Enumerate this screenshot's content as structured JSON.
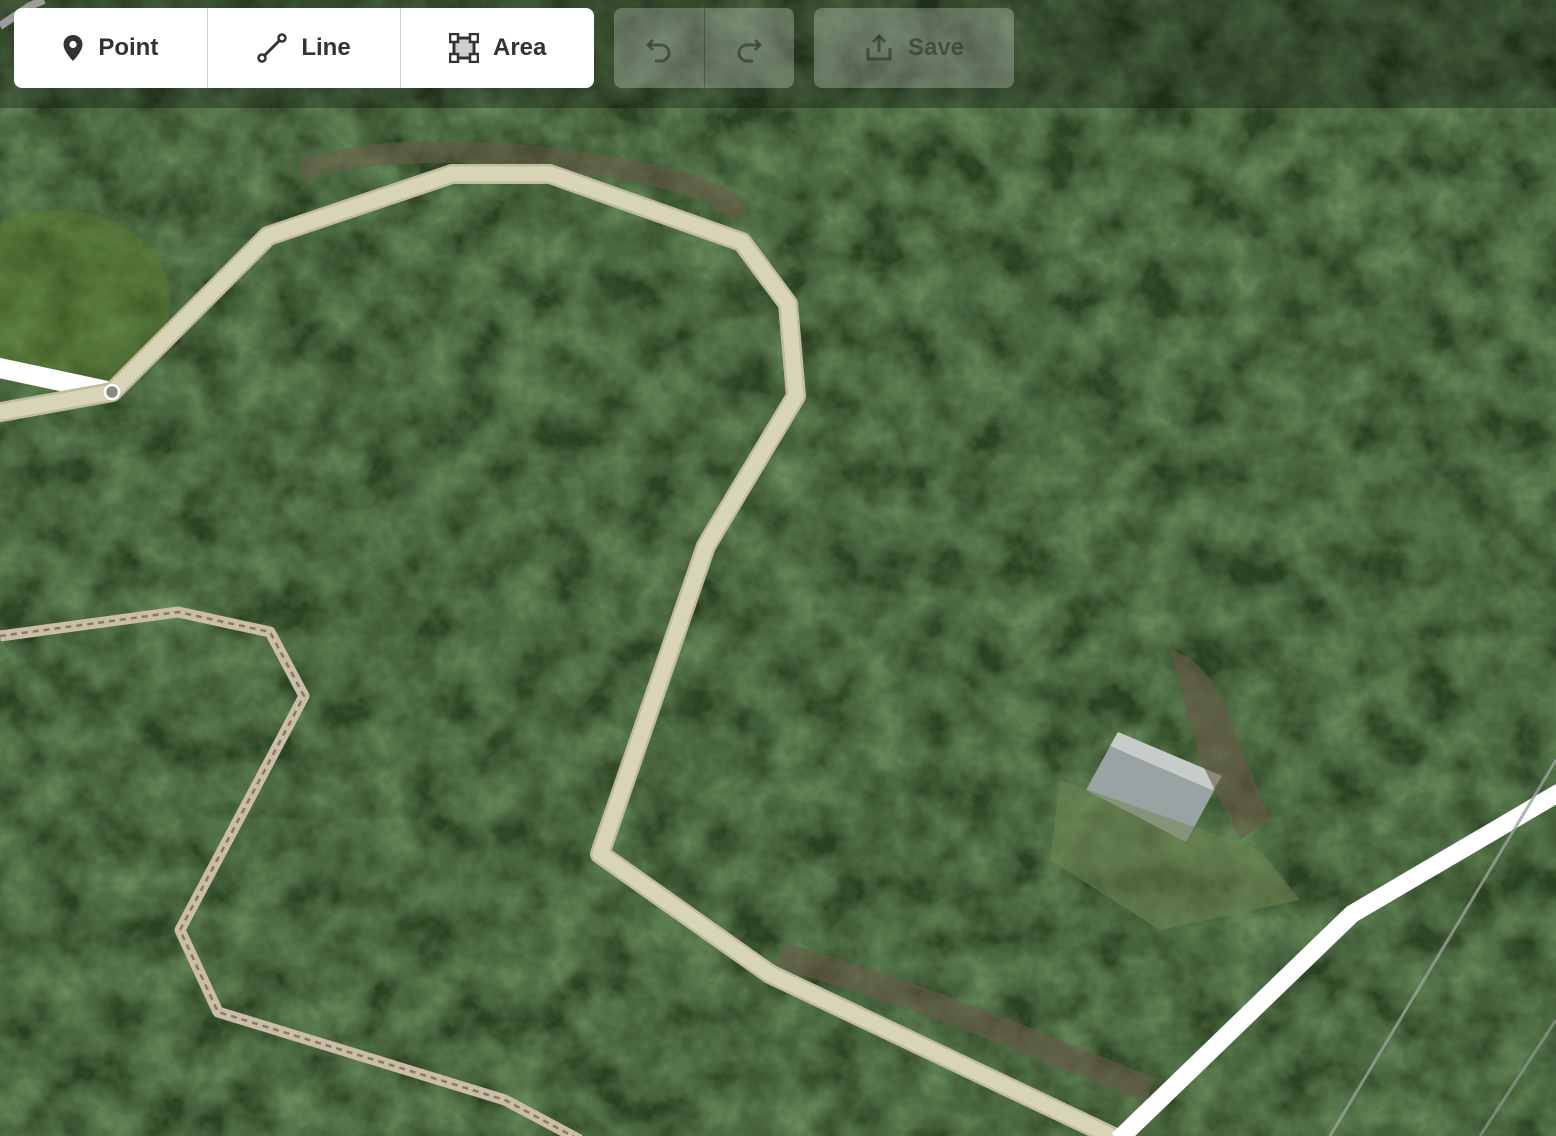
{
  "toolbar": {
    "modes": [
      {
        "label": "Point",
        "icon": "map-pin-icon"
      },
      {
        "label": "Line",
        "icon": "line-icon"
      },
      {
        "label": "Area",
        "icon": "area-icon"
      }
    ],
    "history": [
      {
        "icon": "undo-icon",
        "enabled": false
      },
      {
        "icon": "redo-icon",
        "enabled": false
      }
    ],
    "save": {
      "label": "Save",
      "icon": "upload-icon",
      "enabled": false
    }
  },
  "map": {
    "imagery": "satellite-forest",
    "colors": {
      "track": "#d8d4b6",
      "track_casing": "#bfbb9e",
      "path_dashed": "#c9bda6",
      "road": "#ffffff",
      "vertex": "#8a8a8a"
    }
  }
}
